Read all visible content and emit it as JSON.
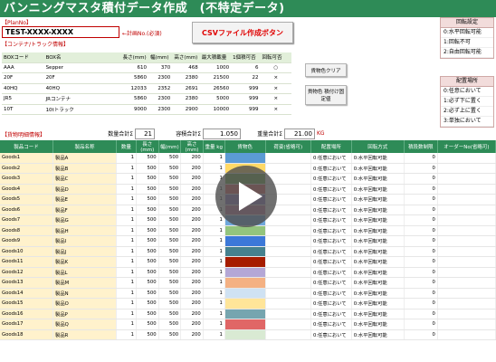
{
  "title": "バンニングマスタ積付データ作成　(不特定データ)",
  "plan": {
    "label": "【PlanNo】",
    "value": "TEST-XXXX-XXXX",
    "hint": "←計画No.(必須)"
  },
  "csv_button": "CSVファイル作成ボタン",
  "container": {
    "label": "【コンテナ/トラック情報】",
    "headers": [
      "BOXコード",
      "BOX名",
      "長さ(mm)",
      "幅(mm)",
      "高さ(mm)",
      "最大積載量",
      "1個積可否",
      "回転可否"
    ],
    "rows": [
      [
        "AAA",
        "Sepper",
        "610",
        "370",
        "468",
        "1000",
        "6",
        "○"
      ],
      [
        "20F",
        "20F",
        "5860",
        "2300",
        "2380",
        "21500",
        "22",
        "×"
      ],
      [
        "40HQ",
        "40HQ",
        "12033",
        "2352",
        "2691",
        "26560",
        "999",
        "×"
      ],
      [
        "JR5",
        "JRコンテナ",
        "5860",
        "2300",
        "2380",
        "5000",
        "999",
        "×"
      ],
      [
        "10T",
        "10tトラック",
        "9000",
        "2300",
        "2900",
        "10000",
        "999",
        "×"
      ]
    ]
  },
  "buttons": {
    "clear": "貨物色クリア",
    "fixed": "貨物色 積付け固定値"
  },
  "rotation": {
    "title": "回転設定",
    "items": [
      "0:水平回転可能",
      "1:回転不可",
      "2:自由回転可能"
    ]
  },
  "placement": {
    "title": "配置場所",
    "items": [
      "0:任意において",
      "1:必ず下に置く",
      "2:必ず上に置く",
      "3:単独において"
    ]
  },
  "goods_label": "【貨物明細情報】",
  "summary": {
    "qty_label": "数量合計Σ",
    "qty": "21",
    "vol_label": "容積合計Σ",
    "vol": "1.050",
    "wt_label": "重量合計Σ",
    "wt": "21.00",
    "wt_unit": "KG"
  },
  "grid": {
    "headers": [
      "製品コード",
      "製品名称",
      "数量",
      "長さ(mm)",
      "幅(mm)",
      "高さ(mm)",
      "重量 kg",
      "貨物色",
      "荷姿(省略可)",
      "配置場所",
      "回転方式",
      "積段数制限",
      "オーダーNo(省略可)"
    ],
    "rows": [
      {
        "code": "Goods1",
        "name": "製品A",
        "qty": "1",
        "l": "500",
        "w": "500",
        "h": "200",
        "wt": "1",
        "color": "#5b9bd5",
        "place": "0:任意において",
        "rot": "0:水平回転可能",
        "lim": "0"
      },
      {
        "code": "Goods2",
        "name": "製品B",
        "qty": "1",
        "l": "500",
        "w": "500",
        "h": "200",
        "wt": "1",
        "color": "#ffd966",
        "place": "0:任意において",
        "rot": "0:水平回転可能",
        "lim": "0"
      },
      {
        "code": "Goods3",
        "name": "製品C",
        "qty": "1",
        "l": "500",
        "w": "500",
        "h": "200",
        "wt": "1",
        "color": "#70ad47",
        "place": "0:任意において",
        "rot": "0:水平回転可能",
        "lim": "0"
      },
      {
        "code": "Goods4",
        "name": "製品D",
        "qty": "1",
        "l": "500",
        "w": "500",
        "h": "200",
        "wt": "1",
        "color": "#e06666",
        "place": "0:任意において",
        "rot": "0:水平回転可能",
        "lim": "0"
      },
      {
        "code": "Goods5",
        "name": "製品E",
        "qty": "1",
        "l": "500",
        "w": "500",
        "h": "200",
        "wt": "1",
        "color": "#8e7cc3",
        "place": "0:任意において",
        "rot": "0:水平回転可能",
        "lim": "0"
      },
      {
        "code": "Goods6",
        "name": "製品F",
        "qty": "1",
        "l": "500",
        "w": "500",
        "h": "200",
        "wt": "1",
        "color": "#c27ba0",
        "place": "0:任意において",
        "rot": "0:水平回転可能",
        "lim": "0"
      },
      {
        "code": "Goods7",
        "name": "製品G",
        "qty": "1",
        "l": "500",
        "w": "500",
        "h": "200",
        "wt": "1",
        "color": "#6fa8dc",
        "place": "0:任意において",
        "rot": "0:水平回転可能",
        "lim": "0"
      },
      {
        "code": "Goods8",
        "name": "製品H",
        "qty": "1",
        "l": "500",
        "w": "500",
        "h": "200",
        "wt": "1",
        "color": "#93c47d",
        "place": "0:任意において",
        "rot": "0:水平回転可能",
        "lim": "0"
      },
      {
        "code": "Goods9",
        "name": "製品I",
        "qty": "1",
        "l": "500",
        "w": "500",
        "h": "200",
        "wt": "1",
        "color": "#3c78d8",
        "place": "0:任意において",
        "rot": "0:水平回転可能",
        "lim": "0"
      },
      {
        "code": "Goods10",
        "name": "製品J",
        "qty": "1",
        "l": "500",
        "w": "500",
        "h": "200",
        "wt": "1",
        "color": "#45818e",
        "place": "0:任意において",
        "rot": "0:水平回転可能",
        "lim": "0"
      },
      {
        "code": "Goods11",
        "name": "製品K",
        "qty": "1",
        "l": "500",
        "w": "500",
        "h": "200",
        "wt": "1",
        "color": "#a61c00",
        "place": "0:任意において",
        "rot": "0:水平回転可能",
        "lim": "0"
      },
      {
        "code": "Goods12",
        "name": "製品L",
        "qty": "1",
        "l": "500",
        "w": "500",
        "h": "200",
        "wt": "1",
        "color": "#b4a7d6",
        "place": "0:任意において",
        "rot": "0:水平回転可能",
        "lim": "0"
      },
      {
        "code": "Goods13",
        "name": "製品M",
        "qty": "1",
        "l": "500",
        "w": "500",
        "h": "200",
        "wt": "1",
        "color": "#f4b183",
        "place": "0:任意において",
        "rot": "0:水平回転可能",
        "lim": "0"
      },
      {
        "code": "Goods14",
        "name": "製品N",
        "qty": "1",
        "l": "500",
        "w": "500",
        "h": "200",
        "wt": "1",
        "color": "#cfe2f3",
        "place": "0:任意において",
        "rot": "0:水平回転可能",
        "lim": "0"
      },
      {
        "code": "Goods15",
        "name": "製品O",
        "qty": "1",
        "l": "500",
        "w": "500",
        "h": "200",
        "wt": "1",
        "color": "#ffe599",
        "place": "0:任意において",
        "rot": "0:水平回転可能",
        "lim": "0"
      },
      {
        "code": "Goods16",
        "name": "製品P",
        "qty": "1",
        "l": "500",
        "w": "500",
        "h": "200",
        "wt": "1",
        "color": "#76a5af",
        "place": "0:任意において",
        "rot": "0:水平回転可能",
        "lim": "0"
      },
      {
        "code": "Goods17",
        "name": "製品Q",
        "qty": "1",
        "l": "500",
        "w": "500",
        "h": "200",
        "wt": "1",
        "color": "#e06666",
        "place": "0:任意において",
        "rot": "0:水平回転可能",
        "lim": "0"
      },
      {
        "code": "Goods18",
        "name": "製品R",
        "qty": "1",
        "l": "500",
        "w": "500",
        "h": "200",
        "wt": "1",
        "color": "#d9ead3",
        "place": "0:任意において",
        "rot": "0:水平回転可能",
        "lim": "0"
      }
    ]
  },
  "colors": {
    "header_green": "#2e8b57",
    "label_red": "#c00000",
    "csv_red": "#e00000"
  },
  "overlay_icon": "play-icon"
}
